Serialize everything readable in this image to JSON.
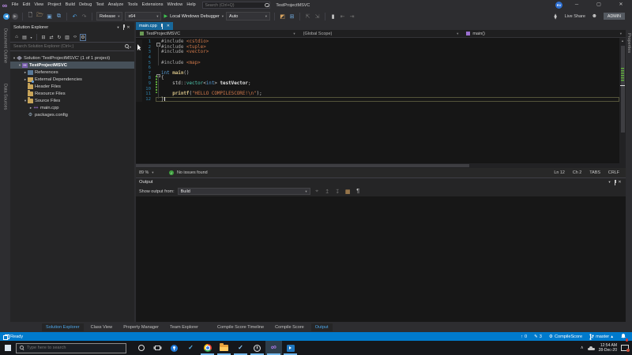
{
  "colors": {
    "accent": "#007ACC",
    "active_tab": "#17679A",
    "status_bar": "#007ACC",
    "change_tracking": "#5FAE3A",
    "selection": "#465059"
  },
  "titlebar": {
    "menus": [
      "File",
      "Edit",
      "View",
      "Project",
      "Build",
      "Debug",
      "Test",
      "Analyze",
      "Tools",
      "Extensions",
      "Window",
      "Help"
    ],
    "search_placeholder": "Search (Ctrl+Q)",
    "project_title": "TestProjectMSVC",
    "avatar_initials": "RV",
    "minimize": "─",
    "maximize": "▢",
    "close": "✕"
  },
  "toolbar": {
    "configuration": "Release",
    "platform": "x64",
    "debug_target": "Local Windows Debugger",
    "auto_combo": "Auto",
    "live_share": "Live Share",
    "admin": "ADMIN"
  },
  "left_strip": {
    "tabs": [
      "Document Outline",
      "Data Sources"
    ]
  },
  "right_strip": {
    "tabs": [
      "Properties"
    ]
  },
  "solution_explorer": {
    "title": "Solution Explorer",
    "search_placeholder": "Search Solution Explorer (Ctrl+;)",
    "items": [
      {
        "label": "Solution 'TestProjectMSVC' (1 of 1 project)",
        "indent": 0,
        "icon": "solution",
        "arrow": "expanded",
        "selected": false,
        "bold": false
      },
      {
        "label": "TestProjectMSVC",
        "indent": 1,
        "icon": "cppproj",
        "arrow": "expanded",
        "selected": true,
        "bold": true
      },
      {
        "label": "References",
        "indent": 2,
        "icon": "refs",
        "arrow": "collapsed",
        "selected": false,
        "bold": false
      },
      {
        "label": "External Dependencies",
        "indent": 2,
        "icon": "deps",
        "arrow": "collapsed",
        "selected": false,
        "bold": false
      },
      {
        "label": "Header Files",
        "indent": 2,
        "icon": "folder",
        "arrow": "none",
        "selected": false,
        "bold": false
      },
      {
        "label": "Resource Files",
        "indent": 2,
        "icon": "folder",
        "arrow": "none",
        "selected": false,
        "bold": false
      },
      {
        "label": "Source Files",
        "indent": 2,
        "icon": "folder",
        "arrow": "expanded",
        "selected": false,
        "bold": false
      },
      {
        "label": "main.cpp",
        "indent": 3,
        "icon": "cppfile",
        "arrow": "collapsed",
        "selected": false,
        "bold": false
      },
      {
        "label": "packages.config",
        "indent": 2,
        "icon": "config",
        "arrow": "none",
        "selected": false,
        "bold": false
      }
    ]
  },
  "editor": {
    "tab_label": "main.cpp",
    "nav_project": "TestProjectMSVC",
    "nav_scope": "(Global Scope)",
    "nav_member": "main()",
    "zoom_level": "89 %",
    "health": "No issues found",
    "line": "Ln 12",
    "column": "Ch 2",
    "indent_mode": "TABS",
    "eol": "CRLF",
    "code": [
      {
        "n": "1",
        "fold": true,
        "current": false,
        "tokens": [
          [
            "#include ",
            "pp"
          ],
          [
            "<cstdio>",
            "str"
          ]
        ]
      },
      {
        "n": "2",
        "fold": false,
        "current": false,
        "tokens": [
          [
            "#include ",
            "pp"
          ],
          [
            "<tuple>",
            "str"
          ]
        ]
      },
      {
        "n": "3",
        "fold": false,
        "current": false,
        "tokens": [
          [
            "#include ",
            "pp"
          ],
          [
            "<vector>",
            "str"
          ]
        ]
      },
      {
        "n": "4",
        "fold": false,
        "current": false,
        "tokens": []
      },
      {
        "n": "5",
        "fold": false,
        "current": false,
        "tokens": [
          [
            "#include ",
            "pp"
          ],
          [
            "<map>",
            "str"
          ]
        ]
      },
      {
        "n": "6",
        "fold": false,
        "current": false,
        "tokens": []
      },
      {
        "n": "7",
        "fold": true,
        "current": false,
        "tokens": [
          [
            "int ",
            "kw"
          ],
          [
            "main",
            "fn"
          ],
          [
            "()",
            "pl"
          ]
        ]
      },
      {
        "n": "8",
        "fold": false,
        "current": false,
        "tokens": [
          [
            "{",
            "pl"
          ]
        ]
      },
      {
        "n": "9",
        "fold": false,
        "current": false,
        "tokens": [
          [
            "    std",
            "pl"
          ],
          [
            "::",
            "pl"
          ],
          [
            "vector",
            "type"
          ],
          [
            "<",
            "pl"
          ],
          [
            "int",
            "kw"
          ],
          [
            "> ",
            "pl"
          ],
          [
            "testVector",
            "var"
          ],
          [
            ";",
            "pl"
          ]
        ]
      },
      {
        "n": "10",
        "fold": false,
        "current": false,
        "tokens": []
      },
      {
        "n": "11",
        "fold": false,
        "current": false,
        "tokens": [
          [
            "    ",
            "pl"
          ],
          [
            "printf",
            "fn"
          ],
          [
            "(",
            "pl"
          ],
          [
            "\"HELLO COMPILESCORE!\\n\"",
            "str"
          ],
          [
            ");",
            "pl"
          ]
        ]
      },
      {
        "n": "12",
        "fold": false,
        "current": true,
        "tokens": [
          [
            "}",
            "pl"
          ]
        ]
      }
    ]
  },
  "output": {
    "title": "Output",
    "show_output_label": "Show output from:",
    "source": "Build"
  },
  "bottom_tabs": {
    "left": [
      {
        "label": "Solution Explorer",
        "active": true
      },
      {
        "label": "Class View",
        "active": false
      },
      {
        "label": "Property Manager",
        "active": false
      },
      {
        "label": "Team Explorer",
        "active": false
      }
    ],
    "right": [
      {
        "label": "Compile Score Timeline",
        "active": false
      },
      {
        "label": "Compile Score",
        "active": false
      },
      {
        "label": "Output",
        "active": true
      }
    ]
  },
  "statusbar": {
    "message": "Ready",
    "outgoing_commits": "0",
    "pending_edits": "3",
    "compilescore": "CompileScore",
    "branch": "master"
  },
  "taskbar": {
    "search_placeholder": "Type here to search",
    "time": "12:54 AM",
    "date": "28-Dec-20"
  }
}
